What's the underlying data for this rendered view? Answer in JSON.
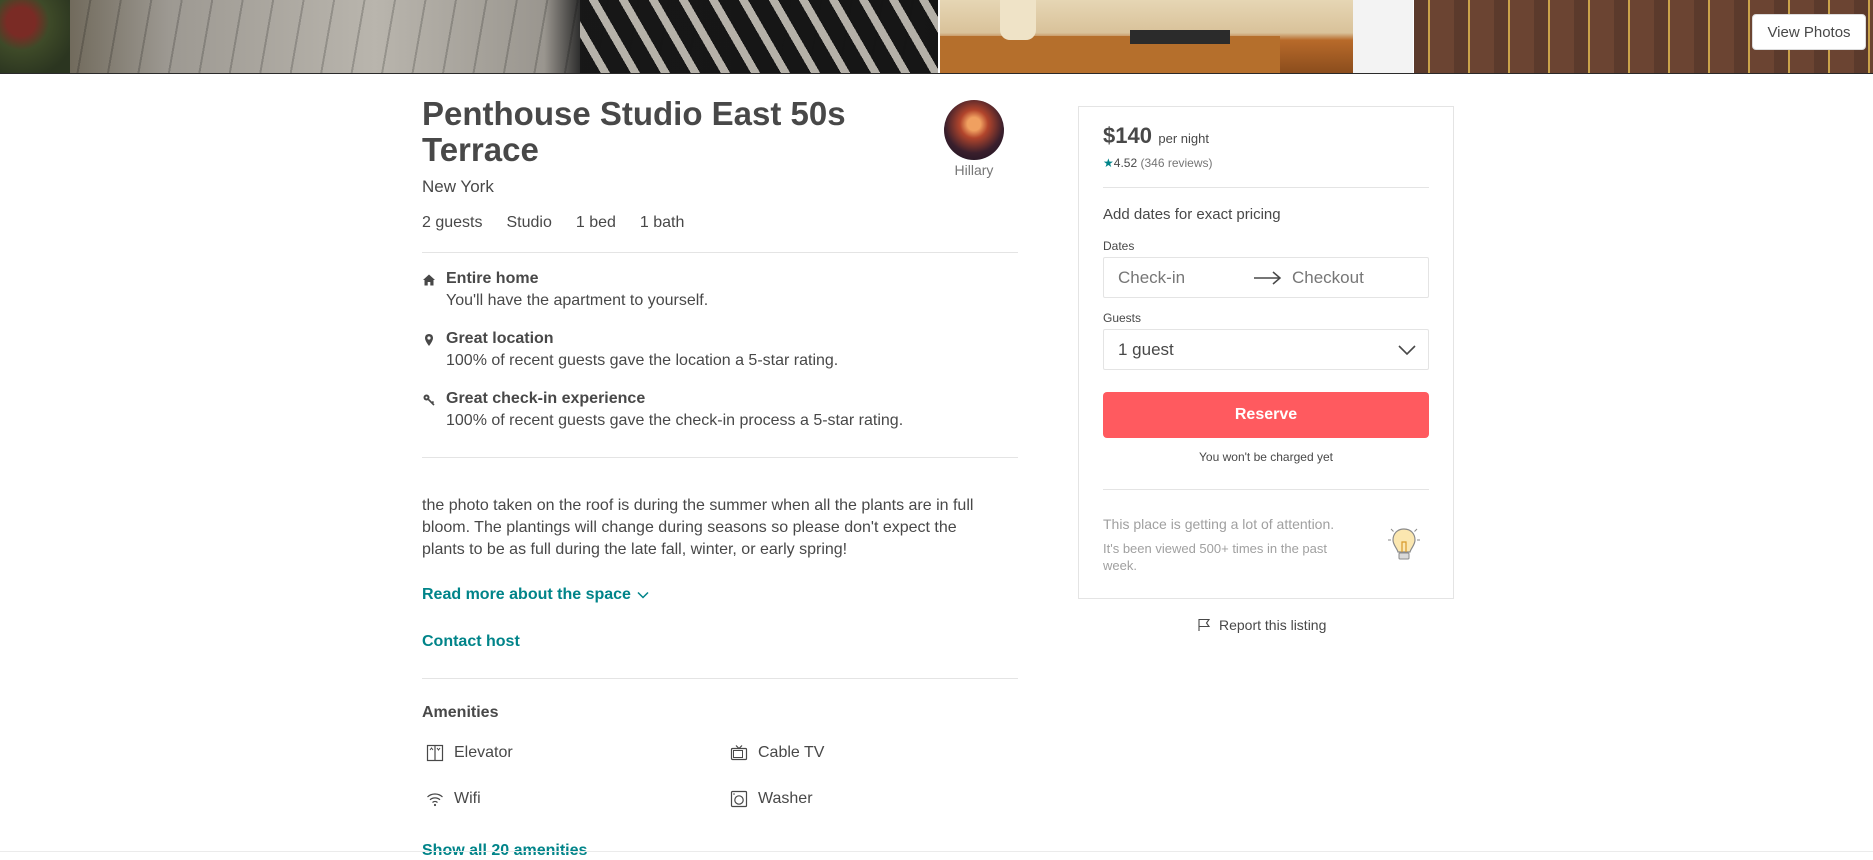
{
  "photos": {
    "view_photos_label": "View Photos"
  },
  "listing": {
    "title": "Penthouse Studio East 50s Terrace",
    "city": "New York",
    "host_name": "Hillary",
    "facts": [
      "2 guests",
      "Studio",
      "1 bed",
      "1 bath"
    ],
    "highlights": [
      {
        "icon": "home-icon",
        "title": "Entire home",
        "desc": "You'll have the apartment to yourself."
      },
      {
        "icon": "location-pin-icon",
        "title": "Great location",
        "desc": "100% of recent guests gave the location a 5-star rating."
      },
      {
        "icon": "key-icon",
        "title": "Great check-in experience",
        "desc": "100% of recent guests gave the check-in process a 5-star rating."
      }
    ],
    "description": "the photo taken on the roof is during the summer when all the plants are in full bloom. The plantings will change during seasons so please don't expect the plants to be as full during the late fall, winter, or early spring!",
    "read_more_label": "Read more about the space",
    "contact_host_label": "Contact host"
  },
  "amenities": {
    "title": "Amenities",
    "items": [
      {
        "icon": "elevator-icon",
        "label": "Elevator"
      },
      {
        "icon": "tv-icon",
        "label": "Cable TV"
      },
      {
        "icon": "wifi-icon",
        "label": "Wifi"
      },
      {
        "icon": "washer-icon",
        "label": "Washer"
      }
    ],
    "show_all_label": "Show all 20 amenities"
  },
  "booking": {
    "price": "$140",
    "price_unit": "per night",
    "rating": "4.52",
    "reviews": "(346 reviews)",
    "add_dates_text": "Add dates for exact pricing",
    "dates_label": "Dates",
    "checkin_placeholder": "Check-in",
    "checkout_placeholder": "Checkout",
    "guests_label": "Guests",
    "guests_value": "1 guest",
    "reserve_label": "Reserve",
    "no_charge_text": "You won't be charged yet",
    "attention_title": "This place is getting a lot of attention.",
    "attention_desc": "It's been viewed 500+ times in the past week.",
    "accent_color": "#ff5a5f",
    "link_color": "#008489"
  },
  "report": {
    "label": "Report this listing"
  }
}
